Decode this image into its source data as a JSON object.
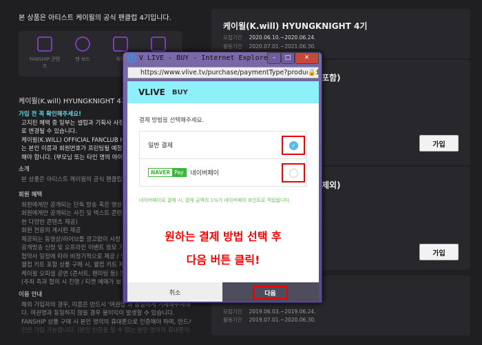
{
  "left": {
    "intro": "본 상품은 아티스트 케이윌의 공식 팬클럽 4기입니다.",
    "features": [
      {
        "label": "FANSHIP 콘텐츠"
      },
      {
        "label": "팬 보드"
      },
      {
        "label": "채팅"
      },
      {
        "label": ""
      }
    ],
    "title": "케이윌(K.will) HYUNGKNIGHT 4기",
    "warning_title": "가입 전 꼭 확인해주세요!",
    "warning_lines": [
      "고지된 혜택 중 일부는 셀럽과 기획사 사정에 의",
      "로 변경될 수 있습니다.",
      "케이윌(K.WILL) OFFICIAL FANCLUB HYUN",
      "는 본인 이름과 회원번호가 프린팅될 예정이니",
      "해야 합니다. (부모님 또는 타인 명의 아이디나"
    ],
    "intro_heading": "소개",
    "intro_lines": [
      "본 상품은 아티스트 케이윌의 공식 팬클럽 4기"
    ],
    "benefits_heading": "회원 혜택",
    "benefit_lines": [
      "회원에게만 공개되는 단독 방송 혹은 영상 시청",
      "회원에게만 공개되는 사진 및 텍스트 콘텐츠 (",
      "한 다양한 콘텐츠 제공)",
      "회원 전용의 게시판 제공",
      "제공되는 동영상/라이브를 광고없이 시청",
      "공개방송 신청 및 오프라인 이벤트 응모 기회 제",
      "협약사 일정에 따라 비정기적으로 제공 / 당첨여",
      "웰컴 키트 포함 상품 구매 시, 웰컴 키트 제공 (",
      "케이윌 오피셜 공연 (콘서트, 팬미팅 등) 진행 시",
      "(주최 측과 협의 시 진행 / 티켓 예매가 보장되는"
    ],
    "usage_heading": "이용 안내",
    "usage_lines": [
      "해외 가입자의 경우, 이름은 반드시 '여권명'과 동일하게 기재해주셔야 합니",
      "다. 여권명과 동일하지 않을 경우 불이익이 발생할 수 있습니다.",
      "FANSHIP 상품 구매 시 본인 명의의 휴대폰으로 인증해야 하며, 반드시 본",
      "인만 가입 가능합니다. (본인 인증을 할 수 없는 본인 명의의 휴대폰이 없는"
    ]
  },
  "cards": [
    {
      "title": "케이윌(K.will) HYUNGKNIGHT 4기",
      "recruit_label": "모집기간",
      "recruit": "2020.06.10.~2020.06.24.",
      "active_label": "활동기간",
      "active": "2020.07.01.~2021.06.30."
    },
    {
      "title": "포함)",
      "button": "가입"
    },
    {
      "title": "제외)",
      "button": "가입"
    },
    {
      "recruit_label": "모집기간",
      "recruit": "2019.06.03.~2019.06.24.",
      "active_label": "활동기간",
      "active": "2019.07.01.~2020.06.30."
    }
  ],
  "popup": {
    "window_title": "V LIVE - BUY - Internet Explorer",
    "url": "https://www.vlive.tv/purchase/paymentType?productId=vlive_",
    "logo": "VLIVE",
    "header": "BUY",
    "prompt": "결제 방법을 선택해주세요.",
    "options": [
      {
        "label": "일반 결제",
        "selected": true
      },
      {
        "label": "네이버페이",
        "naver": "NAVER",
        "pay": "Pay",
        "selected": false
      }
    ],
    "note": "네이버페이로 결제 시, 결제 금액의 1%가 네이버페이 포인트로 적립됩니다.",
    "annotation_line1": "원하는 결제 방법 선택 후",
    "annotation_line2": "다음 버튼 클릭!",
    "cancel": "취소",
    "next": "다음"
  }
}
